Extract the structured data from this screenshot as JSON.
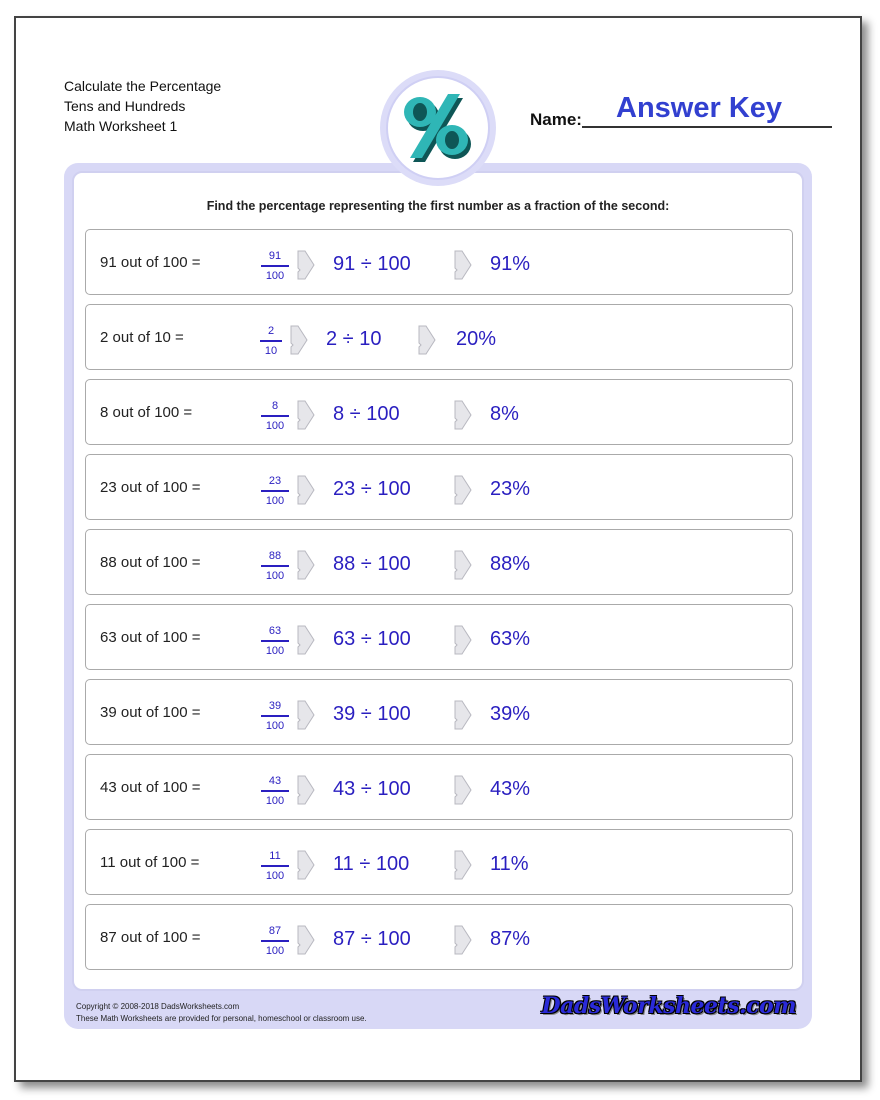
{
  "header": {
    "title_lines": [
      "Calculate the Percentage",
      "Tens and Hundreds",
      "Math Worksheet 1"
    ],
    "logo_icon": "percent-sign-icon",
    "name_label": "Name:",
    "name_value": "Answer Key"
  },
  "instruction": "Find the percentage representing the first number as a fraction of the second:",
  "problems": [
    {
      "question": "91 out of 100 =",
      "numerator": "91",
      "denominator": "100",
      "division": "91 ÷ 100",
      "answer": "91%"
    },
    {
      "question": "2 out of 10 =",
      "numerator": "2",
      "denominator": "10",
      "division": "2 ÷ 10",
      "answer": "20%"
    },
    {
      "question": "8 out of 100 =",
      "numerator": "8",
      "denominator": "100",
      "division": "8 ÷ 100",
      "answer": "8%"
    },
    {
      "question": "23 out of 100 =",
      "numerator": "23",
      "denominator": "100",
      "division": "23 ÷ 100",
      "answer": "23%"
    },
    {
      "question": "88 out of 100 =",
      "numerator": "88",
      "denominator": "100",
      "division": "88 ÷ 100",
      "answer": "88%"
    },
    {
      "question": "63 out of 100 =",
      "numerator": "63",
      "denominator": "100",
      "division": "63 ÷ 100",
      "answer": "63%"
    },
    {
      "question": "39 out of 100 =",
      "numerator": "39",
      "denominator": "100",
      "division": "39 ÷ 100",
      "answer": "39%"
    },
    {
      "question": "43 out of 100 =",
      "numerator": "43",
      "denominator": "100",
      "division": "43 ÷ 100",
      "answer": "43%"
    },
    {
      "question": "11 out of 100 =",
      "numerator": "11",
      "denominator": "100",
      "division": "11 ÷ 100",
      "answer": "11%"
    },
    {
      "question": "87 out of 100 =",
      "numerator": "87",
      "denominator": "100",
      "division": "87 ÷ 100",
      "answer": "87%"
    }
  ],
  "footer": {
    "copyright": "Copyright © 2008-2018 DadsWorksheets.com",
    "usage": "These Math Worksheets are provided for personal, homeschool or classroom use.",
    "brand": "DadsWorksheets.com"
  },
  "colors": {
    "answer": "#2a1fc0",
    "name_answer": "#3240d0",
    "frame": "#d8d8f6",
    "logo_teal": "#2fb6b6"
  }
}
